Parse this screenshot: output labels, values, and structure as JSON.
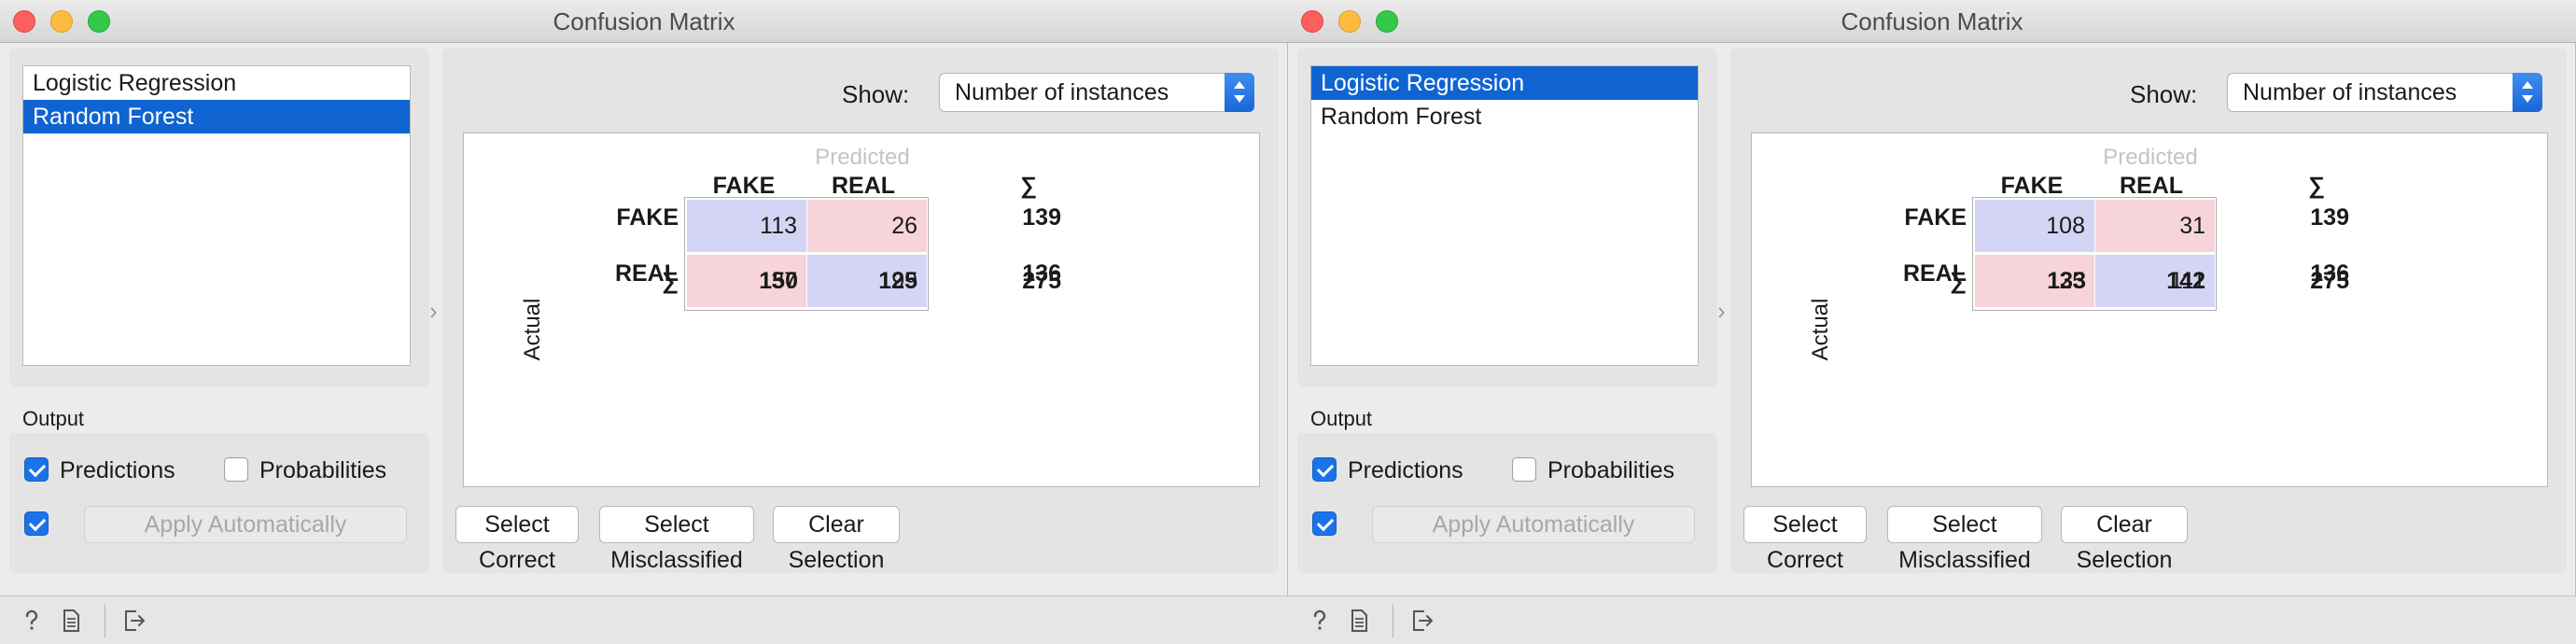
{
  "windows": [
    {
      "title": "Confusion Matrix",
      "learners": [
        {
          "label": "Logistic Regression",
          "selected": false
        },
        {
          "label": "Random Forest",
          "selected": true
        }
      ],
      "output_label": "Output",
      "predictions_label": "Predictions",
      "predictions_checked": true,
      "probabilities_label": "Probabilities",
      "probabilities_checked": false,
      "apply_checked": true,
      "apply_label": "Apply Automatically",
      "show_label": "Show:",
      "show_value": "Number of instances",
      "predicted_label": "Predicted",
      "actual_label": "Actual",
      "columns": [
        "FAKE",
        "REAL"
      ],
      "sum_symbol": "∑",
      "rows": [
        {
          "label": "FAKE",
          "values": [
            "113",
            "26"
          ],
          "sum": "139"
        },
        {
          "label": "REAL",
          "values": [
            "37",
            "99"
          ],
          "sum": "136"
        }
      ],
      "col_sums": [
        "150",
        "125"
      ],
      "total": "275",
      "buttons": {
        "select_correct": "Select Correct",
        "select_misclassified": "Select Misclassified",
        "clear_selection": "Clear Selection"
      }
    },
    {
      "title": "Confusion Matrix",
      "learners": [
        {
          "label": "Logistic Regression",
          "selected": true
        },
        {
          "label": "Random Forest",
          "selected": false
        }
      ],
      "output_label": "Output",
      "predictions_label": "Predictions",
      "predictions_checked": true,
      "probabilities_label": "Probabilities",
      "probabilities_checked": false,
      "apply_checked": true,
      "apply_label": "Apply Automatically",
      "show_label": "Show:",
      "show_value": "Number of instances",
      "predicted_label": "Predicted",
      "actual_label": "Actual",
      "columns": [
        "FAKE",
        "REAL"
      ],
      "sum_symbol": "∑",
      "rows": [
        {
          "label": "FAKE",
          "values": [
            "108",
            "31"
          ],
          "sum": "139"
        },
        {
          "label": "REAL",
          "values": [
            "25",
            "111"
          ],
          "sum": "136"
        }
      ],
      "col_sums": [
        "133",
        "142"
      ],
      "total": "275",
      "buttons": {
        "select_correct": "Select Correct",
        "select_misclassified": "Select Misclassified",
        "clear_selection": "Clear Selection"
      }
    }
  ],
  "colors": {
    "selection": "#0f64d2",
    "diagonal_cell": "#d4d4f5",
    "off_diagonal_cell": "#f7d4d9",
    "checkbox": "#1a73e8"
  },
  "icons": {
    "statusbar": [
      "help-icon",
      "report-icon",
      "output-icon"
    ]
  }
}
